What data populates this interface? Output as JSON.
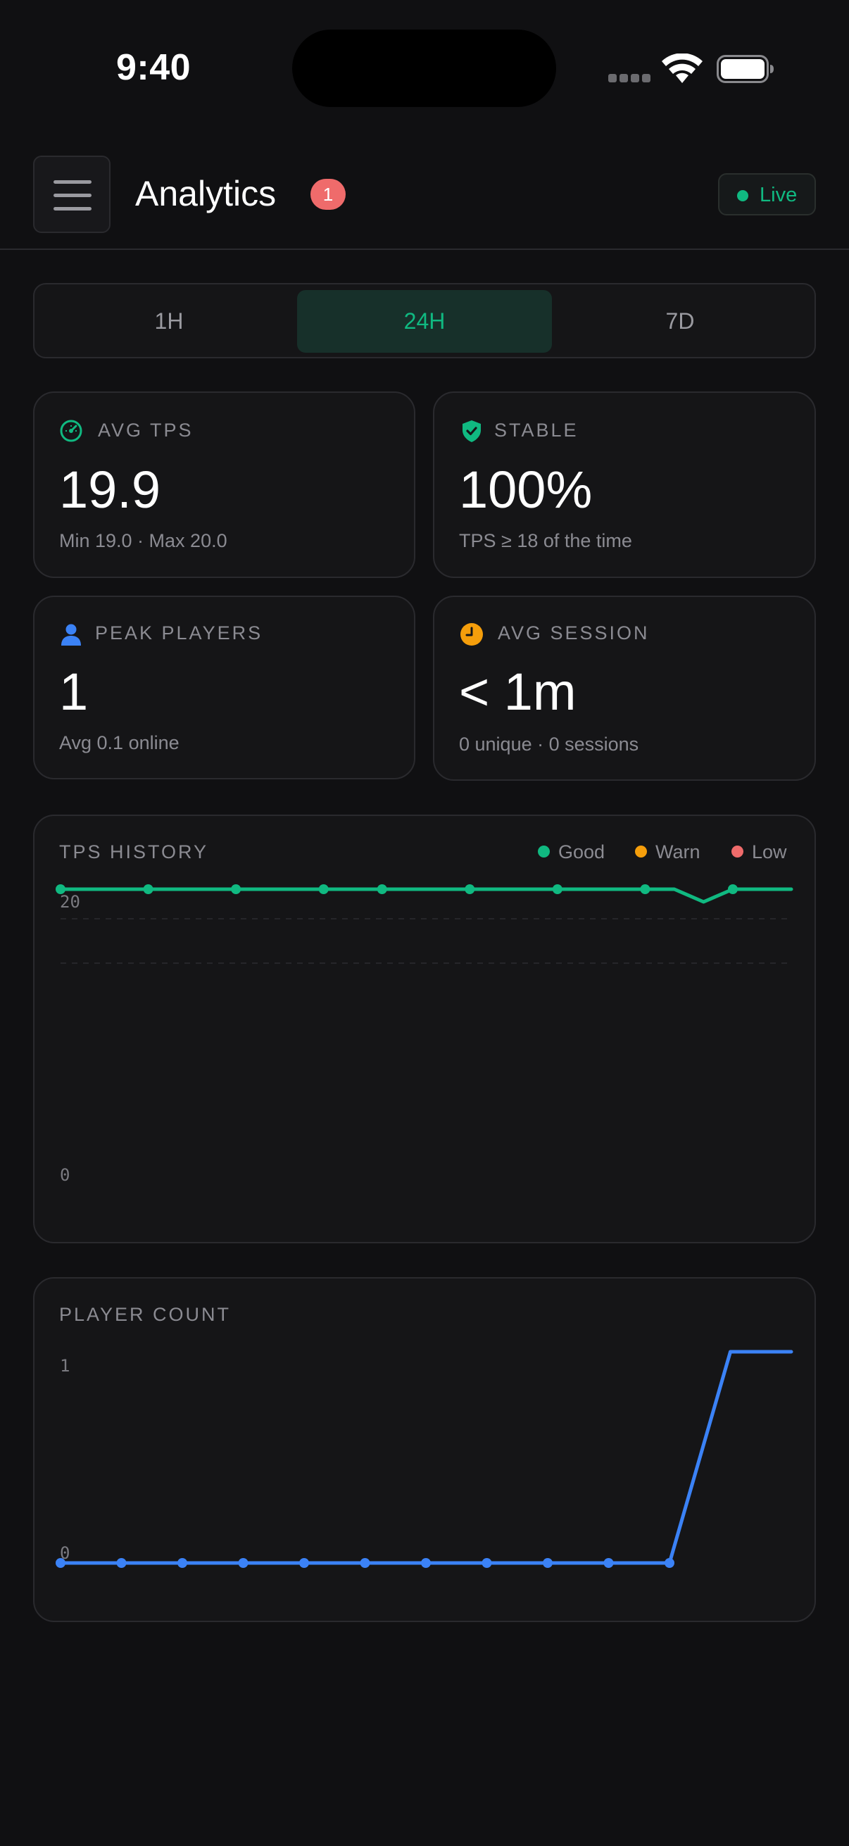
{
  "status_bar": {
    "time": "9:40",
    "icons": [
      "cellular-signal-icon",
      "wifi-icon",
      "battery-icon"
    ]
  },
  "header": {
    "menu_icon": "hamburger-menu-icon",
    "title": "Analytics",
    "badge_count": "1",
    "live_label": "Live"
  },
  "range_tabs": {
    "items": [
      "1H",
      "24H",
      "7D"
    ],
    "selected": "24H"
  },
  "stats": {
    "avg_tps": {
      "icon": "speedometer-icon",
      "label": "AVG TPS",
      "value": "19.9",
      "sub": "Min 19.0 · Max 20.0"
    },
    "stable": {
      "icon": "shield-check-icon",
      "label": "STABLE",
      "value": "100%",
      "sub": "TPS ≥ 18 of the time"
    },
    "peak_players": {
      "icon": "user-icon",
      "label": "PEAK PLAYERS",
      "value": "1",
      "sub": "Avg 0.1 online"
    },
    "avg_session": {
      "icon": "clock-icon",
      "label": "AVG SESSION",
      "value": "< 1m",
      "sub": "0 unique · 0 sessions"
    }
  },
  "colors": {
    "accent_green": "#10b981",
    "warn_orange": "#f59e0b",
    "low_red": "#ef6b6b",
    "player_blue": "#3b82f6",
    "background": "#101012",
    "card": "#151517"
  },
  "chart_data": [
    {
      "type": "line",
      "title": "TPS HISTORY",
      "legend": [
        {
          "name": "Good",
          "color": "#10b981"
        },
        {
          "name": "Warn",
          "color": "#f59e0b"
        },
        {
          "name": "Low",
          "color": "#ef6b6b"
        }
      ],
      "legend_position": "top-right",
      "y_ticks": [
        "20",
        "0"
      ],
      "ylim": [
        0,
        20
      ],
      "series": [
        {
          "values": [
            20,
            20,
            20,
            20,
            20,
            20,
            20,
            20,
            20,
            20,
            20,
            20,
            20,
            20,
            20,
            20,
            20,
            20,
            20,
            20,
            20,
            20,
            19,
            20,
            20,
            20
          ],
          "markers": [
            0,
            3,
            6,
            9,
            11,
            14,
            17,
            20,
            23
          ],
          "color": "#10b981"
        }
      ],
      "grid": "dashed"
    },
    {
      "type": "line",
      "title": "PLAYER COUNT",
      "y_ticks": [
        "1",
        "0"
      ],
      "ylim": [
        0,
        1
      ],
      "series": [
        {
          "values": [
            0,
            0,
            0,
            0,
            0,
            0,
            0,
            0,
            0,
            0,
            0,
            1,
            1
          ],
          "markers": [
            0,
            1,
            2,
            3,
            4,
            5,
            6,
            7,
            8,
            9,
            10
          ],
          "color": "#3b82f6"
        }
      ],
      "grid": "none"
    }
  ]
}
